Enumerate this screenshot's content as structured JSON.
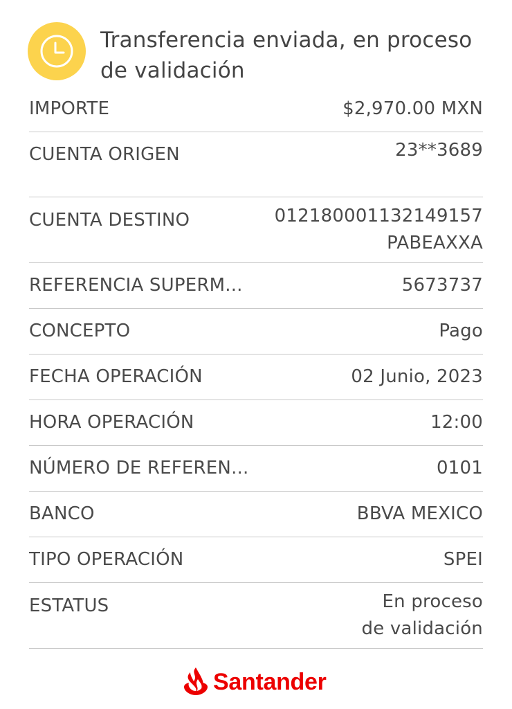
{
  "header": {
    "title": "Transferencia enviada, en proceso de validación",
    "status_icon": "clock-icon",
    "badge_color": "#fcd34d"
  },
  "details": {
    "importe": {
      "label": "IMPORTE",
      "value": "$2,970.00 MXN"
    },
    "cuenta_origen": {
      "label": "CUENTA ORIGEN",
      "value": "23**3689"
    },
    "cuenta_destino": {
      "label": "CUENTA DESTINO",
      "value_line1": "012180001132149157",
      "value_line2": "PABEAXXA"
    },
    "referencia_superm": {
      "label": "REFERENCIA SUPERM...",
      "value": "5673737"
    },
    "concepto": {
      "label": "CONCEPTO",
      "value": "Pago"
    },
    "fecha_operacion": {
      "label": "FECHA OPERACIÓN",
      "value": "02 Junio, 2023"
    },
    "hora_operacion": {
      "label": "HORA OPERACIÓN",
      "value": "12:00"
    },
    "numero_referencia": {
      "label": "NÚMERO DE REFEREN...",
      "value": "0101"
    },
    "banco": {
      "label": "BANCO",
      "value": "BBVA MEXICO"
    },
    "tipo_operacion": {
      "label": "TIPO OPERACIÓN",
      "value": "SPEI"
    },
    "estatus": {
      "label": "ESTATUS",
      "value_line1": "En proceso",
      "value_line2": "de validación"
    }
  },
  "footer": {
    "brand_name": "Santander",
    "brand_icon": "flame-logo-icon",
    "brand_color": "#ec0000"
  }
}
